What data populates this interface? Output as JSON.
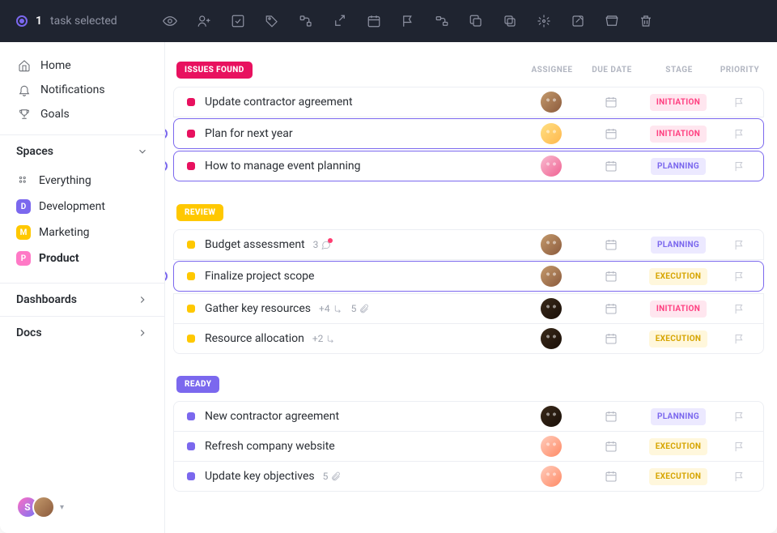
{
  "topbar": {
    "selected_count": "1",
    "selected_label": "task selected"
  },
  "sidebar": {
    "nav": [
      {
        "label": "Home"
      },
      {
        "label": "Notifications"
      },
      {
        "label": "Goals"
      }
    ],
    "spaces_header": "Spaces",
    "spaces": [
      {
        "label": "Everything",
        "letter": "",
        "color": ""
      },
      {
        "label": "Development",
        "letter": "D",
        "color": "#7b68ee"
      },
      {
        "label": "Marketing",
        "letter": "M",
        "color": "#ffc800"
      },
      {
        "label": "Product",
        "letter": "P",
        "color": "#ff79c6",
        "active": true
      }
    ],
    "dashboards_label": "Dashboards",
    "docs_label": "Docs",
    "footer_initial": "S"
  },
  "columns": {
    "assignee": "ASSIGNEE",
    "due": "DUE DATE",
    "stage": "STAGE",
    "priority": "PRIORITY"
  },
  "stages": {
    "initiation": {
      "label": "INITIATION",
      "bg": "#ffe6ef",
      "fg": "#ff4081"
    },
    "planning": {
      "label": "PLANNING",
      "bg": "#ece9ff",
      "fg": "#7b68ee"
    },
    "execution": {
      "label": "EXECUTION",
      "bg": "#fff7dc",
      "fg": "#d6a400"
    }
  },
  "groups": [
    {
      "status": "ISSUES FOUND",
      "color": "#e8115f",
      "sq": "#e8115f",
      "tasks": [
        {
          "name": "Update contractor agreement",
          "avatar": "av1",
          "stage": "initiation",
          "selected": false,
          "radio": false
        },
        {
          "name": "Plan for next year",
          "avatar": "av2",
          "stage": "initiation",
          "selected": true,
          "radio": true
        },
        {
          "name": "How to manage event planning",
          "avatar": "av3",
          "stage": "planning",
          "selected": true,
          "radio": true
        }
      ]
    },
    {
      "status": "REVIEW",
      "color": "#ffc800",
      "sq": "#ffc800",
      "tasks": [
        {
          "name": "Budget assessment",
          "avatar": "av1",
          "stage": "planning",
          "selected": false,
          "radio": false,
          "comments": "3",
          "comment_dot": true
        },
        {
          "name": "Finalize project scope",
          "avatar": "av1",
          "stage": "execution",
          "selected": true,
          "radio": true
        },
        {
          "name": "Gather key resources",
          "avatar": "av4",
          "stage": "initiation",
          "selected": false,
          "radio": false,
          "subtasks": "+4",
          "attachments": "5"
        },
        {
          "name": "Resource allocation",
          "avatar": "av4",
          "stage": "execution",
          "selected": false,
          "radio": false,
          "subtasks": "+2"
        }
      ]
    },
    {
      "status": "READY",
      "color": "#7b68ee",
      "sq": "#7b68ee",
      "tasks": [
        {
          "name": "New contractor agreement",
          "avatar": "av4",
          "stage": "planning",
          "selected": false,
          "radio": false
        },
        {
          "name": "Refresh company website",
          "avatar": "av5",
          "stage": "execution",
          "selected": false,
          "radio": false
        },
        {
          "name": "Update key objectives",
          "avatar": "av5",
          "stage": "execution",
          "selected": false,
          "radio": false,
          "attachments": "5"
        }
      ]
    }
  ]
}
